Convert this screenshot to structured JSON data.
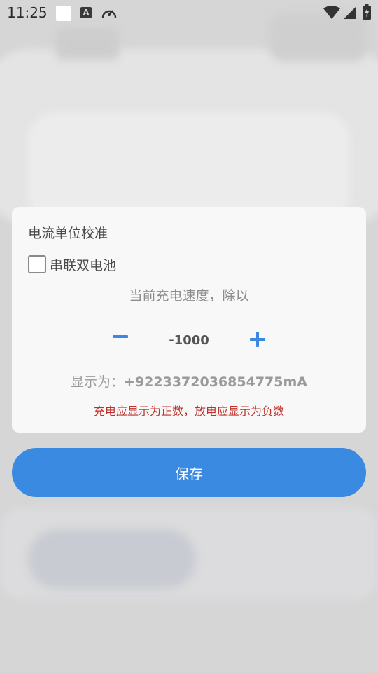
{
  "status_bar": {
    "time": "11:25",
    "a_icon_letter": "A"
  },
  "dialog": {
    "title": "电流单位校准",
    "checkbox_label": "串联双电池",
    "checkbox_checked": false,
    "hint": "当前充电速度，除以",
    "divisor": "-1000",
    "display_prefix": "显示为：",
    "display_value": "+9223372036854775mA",
    "warning": "充电应显示为正数，放电应显示为负数"
  },
  "save_button": {
    "label": "保存"
  },
  "colors": {
    "accent": "#3a8ae2",
    "warning": "#c0302a"
  },
  "icons": {
    "minus": "minus-icon",
    "plus": "plus-icon",
    "wifi": "wifi-icon",
    "signal": "signal-icon",
    "battery": "battery-charging-icon",
    "gauge": "gauge-icon"
  }
}
